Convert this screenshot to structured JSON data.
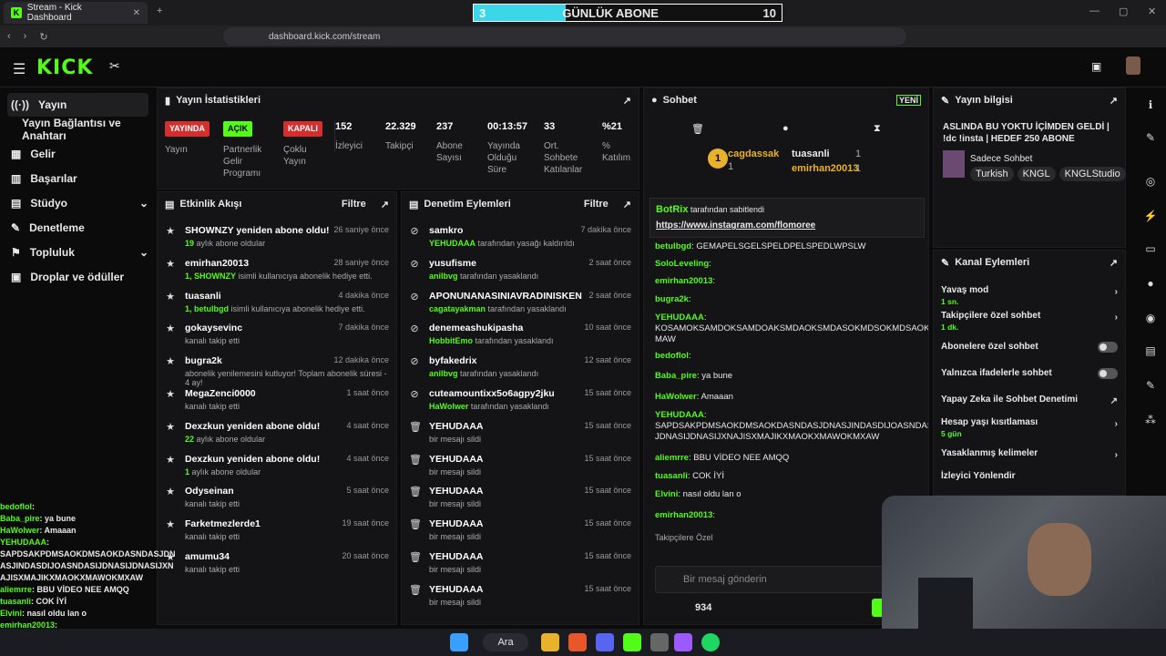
{
  "browser": {
    "tab_title": "Stream - Kick Dashboard",
    "url": "dashboard.kick.com/stream"
  },
  "sub_goal": {
    "current": "3",
    "label": "GÜNLÜK ABONE",
    "target": "10",
    "progress": 0.3
  },
  "sidebar": {
    "items": [
      {
        "label": "Yayın"
      },
      {
        "label": "Yayın Bağlantısı ve Anahtarı"
      },
      {
        "label": "Gelir"
      },
      {
        "label": "Başarılar"
      },
      {
        "label": "Stüdyo"
      },
      {
        "label": "Denetleme"
      },
      {
        "label": "Topluluk"
      },
      {
        "label": "Droplar ve ödüller"
      }
    ]
  },
  "stats": {
    "title": "Yayın İstatistikleri",
    "items": [
      {
        "top": "YAYINDA",
        "label": "Yayın"
      },
      {
        "top": "AÇIK",
        "label": "Partnerlik Gelir Programı"
      },
      {
        "top": "KAPALI",
        "label": "Çoklu Yayın"
      },
      {
        "top": "152",
        "label": "İzleyici"
      },
      {
        "top": "22.329",
        "label": "Takipçi"
      },
      {
        "top": "237",
        "label": "Abone Sayısı"
      },
      {
        "top": "00:13:57",
        "label": "Yayında Olduğu Süre"
      },
      {
        "top": "33",
        "label": "Ort. Sohbete Katılanlar"
      },
      {
        "top": "%21",
        "label": "% Katılım"
      }
    ]
  },
  "activity": {
    "title": "Etkinlik Akışı",
    "filter": "Filtre",
    "items": [
      {
        "title": "SHOWNZY yeniden abone oldu!",
        "time": "26 saniye önce",
        "hl": "19",
        "sub": " aylık abone oldular"
      },
      {
        "title": "emirhan20013",
        "time": "28 saniye önce",
        "hl": "1, SHOWNZY",
        "sub": " isimli kullanıcıya abonelik hediye etti."
      },
      {
        "title": "tuasanli",
        "time": "4 dakika önce",
        "hl": "1, betulbgd",
        "sub": " isimli kullanıcıya abonelik hediye etti."
      },
      {
        "title": "gokaysevinc",
        "time": "7 dakika önce",
        "hl": "",
        "sub": "kanalı takip etti"
      },
      {
        "title": "bugra2k",
        "time": "12 dakika önce",
        "hl": "",
        "sub": "abonelik yenilemesini kutluyor! Toplam abonelik süresi - 4 ay!"
      },
      {
        "title": "MegaZenci0000",
        "time": "1 saat önce",
        "hl": "",
        "sub": "kanalı takip etti"
      },
      {
        "title": "Dexzkun yeniden abone oldu!",
        "time": "4 saat önce",
        "hl": "22",
        "sub": " aylık abone oldular"
      },
      {
        "title": "Dexzkun yeniden abone oldu!",
        "time": "4 saat önce",
        "hl": "1",
        "sub": " aylık abone oldular"
      },
      {
        "title": "Odyseinan",
        "time": "5 saat önce",
        "hl": "",
        "sub": "kanalı takip etti"
      },
      {
        "title": "Farketmezlerde1",
        "time": "19 saat önce",
        "hl": "",
        "sub": "kanalı takip etti"
      },
      {
        "title": "amumu34",
        "time": "20 saat önce",
        "hl": "",
        "sub": "kanalı takip etti"
      }
    ]
  },
  "moderation": {
    "title": "Denetim Eylemleri",
    "filter": "Filtre",
    "items": [
      {
        "title": "samkro",
        "time": "7 dakika önce",
        "hl": "YEHUDAAA",
        "sub": " tarafından yasağı kaldırıldı"
      },
      {
        "title": "yusufisme",
        "time": "2 saat önce",
        "hl": "anilbvg",
        "sub": " tarafından yasaklandı"
      },
      {
        "title": "APONUNANASINIAVRADINISKEN",
        "time": "2 saat önce",
        "hl": "cagatayakman",
        "sub": " tarafından yasaklandı"
      },
      {
        "title": "denemeashukipasha",
        "time": "10 saat önce",
        "hl": "HobbitEmo",
        "sub": " tarafından yasaklandı"
      },
      {
        "title": "byfakedrix",
        "time": "12 saat önce",
        "hl": "anilbvg",
        "sub": " tarafından yasaklandı"
      },
      {
        "title": "cuteamountixx5o6agpy2jku",
        "time": "15 saat önce",
        "hl": "HaWolwer",
        "sub": " tarafından yasaklandı"
      },
      {
        "title": "YEHUDAAA",
        "time": "15 saat önce",
        "hl": "",
        "sub": "bir mesajı sildi"
      },
      {
        "title": "YEHUDAAA",
        "time": "15 saat önce",
        "hl": "",
        "sub": "bir mesajı sildi"
      },
      {
        "title": "YEHUDAAA",
        "time": "15 saat önce",
        "hl": "",
        "sub": "bir mesajı sildi"
      },
      {
        "title": "YEHUDAAA",
        "time": "15 saat önce",
        "hl": "",
        "sub": "bir mesajı sildi"
      },
      {
        "title": "YEHUDAAA",
        "time": "15 saat önce",
        "hl": "",
        "sub": "bir mesajı sildi"
      },
      {
        "title": "YEHUDAAA",
        "time": "15 saat önce",
        "hl": "",
        "sub": "bir mesajı sildi"
      }
    ]
  },
  "chat": {
    "title": "Sohbet",
    "new": "YENİ",
    "top_users": [
      {
        "name": "cagdassak",
        "count": "1"
      },
      {
        "name": "tuasanli",
        "count": "1"
      },
      {
        "name": "emirhan20013",
        "count": "1"
      }
    ],
    "pinned_by": "BotRix",
    "pinned_suffix": " tarafından sabitlendi",
    "pinned_link": "https://www.instagram.com/flomoree",
    "messages": [
      {
        "user": "betulbgd",
        "text": ": GEMAPELSGELSPELDPELSPEDLWPSLW"
      },
      {
        "user": "SoloLeveling",
        "text": ":"
      },
      {
        "user": "emirhan20013",
        "text": ":"
      },
      {
        "user": "bugra2k",
        "text": ":"
      },
      {
        "user": "YEHUDAAA",
        "text": ": KOSAMOKSAMDOKSAMDOAKSMDAOKSMDASOKMDSOKMDSAOKX MAW"
      },
      {
        "user": "bedoflol",
        "text": ":"
      },
      {
        "user": "Baba_pire",
        "text": ": ya bune"
      },
      {
        "user": "HaWolwer",
        "text": ": Amaaan"
      },
      {
        "user": "YEHUDAAA",
        "text": ": SAPDSAKPDMSAOKDMSAOKDASNDASJDNASJINDASDIJOASNDASI JDNASIJDNASIJXNAJISXMAJIKXMAOKXMAWOKMXAW"
      },
      {
        "user": "aliemrre",
        "text": ": BBU VİDEO NEE AMQQ"
      },
      {
        "user": "tuasanli",
        "text": ": COK İYİ"
      },
      {
        "user": "Elvini",
        "text": ": nasıl oldu lan o"
      },
      {
        "user": "emirhan20013",
        "text": ":"
      }
    ],
    "emote_label": "Takipçilere Özel",
    "placeholder": "Bir mesaj gönderin",
    "viewers": "934"
  },
  "stream_info": {
    "title_label": "Yayın bilgisi",
    "stream_title": "ASLINDA BU YOKTU İÇİMDEN GELDİ | !dc !insta | HEDEF 250 ABONE",
    "category": "Sadece Sohbet",
    "tags": [
      "Turkish",
      "KNGL",
      "KNGLStudio"
    ]
  },
  "channel_actions": {
    "title": "Kanal Eylemleri",
    "items": [
      {
        "label": "Yavaş mod",
        "sub": "1 sn."
      },
      {
        "label": "Takipçilere özel sohbet",
        "sub": "1 dk."
      },
      {
        "label": "Abonelere özel sohbet",
        "sub": ""
      },
      {
        "label": "Yalnızca ifadelerle sohbet",
        "sub": ""
      },
      {
        "label": "Yapay Zeka ile Sohbet Denetimi",
        "sub": ""
      },
      {
        "label": "Hesap yaşı kısıtlaması",
        "sub": "5 gün"
      },
      {
        "label": "Yasaklanmış kelimeler",
        "sub": ""
      },
      {
        "label": "İzleyici Yönlendir",
        "sub": ""
      }
    ]
  },
  "overlay_chat": [
    {
      "user": "bedoflol",
      "text": ":"
    },
    {
      "user": "Baba_pire",
      "text": ": ya bune"
    },
    {
      "user": "HaWolwer",
      "text": ": Amaaan"
    },
    {
      "user": "YEHUDAAA",
      "text": ": SAPDSAKPDMSAOKDMSAOKDASNDASJDN ASJINDASDIJOASNDASIJDNASIJDNASIJXN AJISXMAJIKXMAOKXMAWOKMXAW"
    },
    {
      "user": "aliemrre",
      "text": ": BBU VİDEO NEE AMQQ"
    },
    {
      "user": "tuasanli",
      "text": ": COK İYİ"
    },
    {
      "user": "Elvini",
      "text": ": nasıl oldu lan o"
    },
    {
      "user": "emirhan20013",
      "text": ":"
    }
  ],
  "taskbar": {
    "search": "Ara"
  },
  "colors": {
    "brand": "#53fc18",
    "live": "#d32f2f",
    "goal_fill": "#3ad6ea"
  }
}
